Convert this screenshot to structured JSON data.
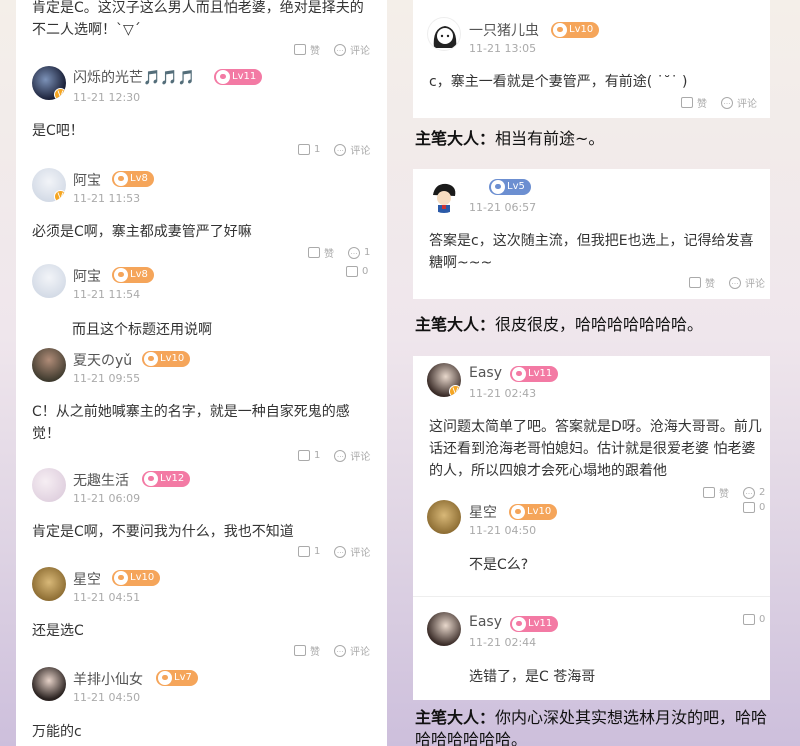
{
  "left_comments": [
    {
      "name": "",
      "level": "",
      "time": "",
      "text": "肯定是C。这汉子这么男人而且怕老婆，绝对是择夫的不二人选啊！`▽´",
      "likes": "赞",
      "comment_label": "评论"
    },
    {
      "name": "闪烁的光芒🎵🎵🎵",
      "level": "Lv11",
      "time": "11-21 12:30",
      "text": "是C吧！",
      "likes": "1",
      "comment_label": "评论"
    },
    {
      "name": "阿宝",
      "level": "Lv8",
      "time": "11-21 11:53",
      "text": "必须是C啊，寨主都成妻管严了好嘛",
      "likes": "赞",
      "comment_label": "1"
    },
    {
      "name": "阿宝",
      "level": "Lv8",
      "time": "11-21 11:54",
      "text": "而且这个标题还用说啊",
      "likes": "0",
      "comment_label": ""
    },
    {
      "name": "夏天のyǔ",
      "level": "Lv10",
      "time": "11-21 09:55",
      "text": "C！从之前她喊寨主的名字，就是一种自家死鬼的感觉！",
      "likes": "1",
      "comment_label": "评论"
    },
    {
      "name": "无趣生活",
      "level": "Lv12",
      "time": "11-21 06:09",
      "text": "肯定是C啊，不要问我为什么，我也不知道",
      "likes": "1",
      "comment_label": "评论"
    },
    {
      "name": "星空",
      "level": "Lv10",
      "time": "11-21 04:51",
      "text": "还是选C",
      "likes": "赞",
      "comment_label": "评论"
    },
    {
      "name": "羊排小仙女",
      "level": "Lv7",
      "time": "11-21 04:50",
      "text": "万能的c",
      "likes": "",
      "comment_label": ""
    }
  ],
  "right_cards": [
    {
      "name": "一只猪儿虫",
      "level": "Lv10",
      "time": "11-21 13:05",
      "text": "c，寨主一看就是个妻管严，有前途( ˙˘˙ )",
      "likes": "赞",
      "comment_label": "评论"
    },
    {
      "name": "",
      "level": "Lv5",
      "time": "11-21 06:57",
      "text": "答案是c，这次随主流，但我把E也选上，记得给发喜糖啊~~~",
      "likes": "赞",
      "comment_label": "评论"
    },
    {
      "name": "Easy",
      "level": "Lv11",
      "time": "11-21 02:43",
      "text": "这问题太简单了吧。答案就是D呀。沧海大哥哥。前几话还看到沧海老哥怕媳妇。估计就是很爱老婆 怕老婆的人，所以四娘才会死心塌地的跟着他",
      "likes": "赞",
      "comment_label": "2"
    },
    {
      "name": "星空",
      "level": "Lv10",
      "time": "11-21 04:50",
      "text": "不是C么?",
      "likes": "0",
      "comment_label": ""
    },
    {
      "name": "Easy",
      "level": "Lv11",
      "time": "11-21 02:44",
      "text": "选错了，是C 苍海哥",
      "likes": "0",
      "comment_label": ""
    }
  ],
  "author_notes": [
    {
      "prefix": "主笔大人：",
      "text": "相当有前途~。"
    },
    {
      "prefix": "主笔大人：",
      "text": "很皮很皮，哈哈哈哈哈哈哈。"
    },
    {
      "prefix": "主笔大人：",
      "text": "你内心深处其实想选林月汝的吧，哈哈哈哈哈哈哈哈。"
    }
  ],
  "colors": {
    "level_orange": "#f5a55a",
    "level_pink": "#f37aa4",
    "level_blue": "#6c8fd1",
    "verified": "#f5a623"
  }
}
